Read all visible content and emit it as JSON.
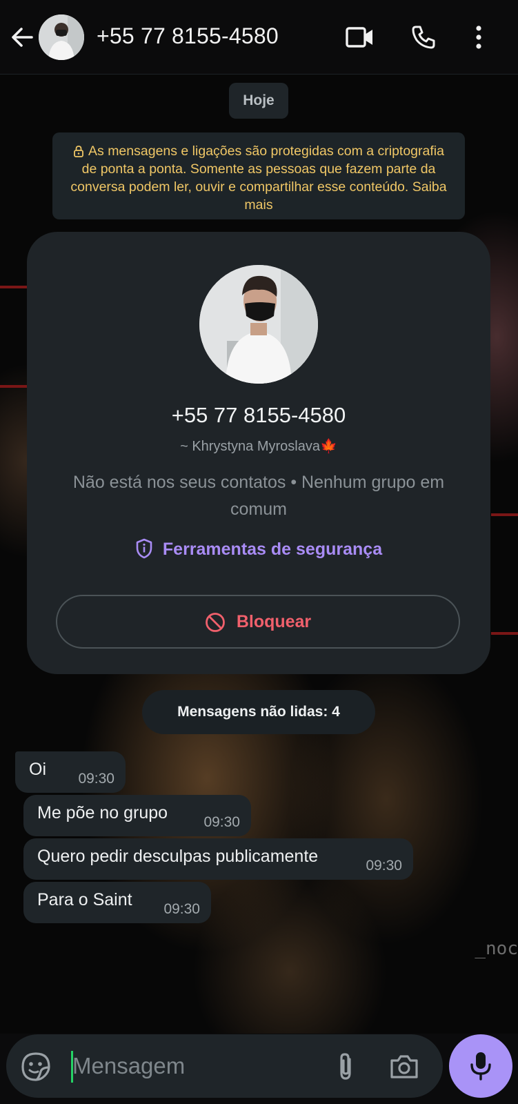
{
  "header": {
    "title": "+55 77 8155-4580",
    "back_icon": "arrow-left-icon",
    "icons": [
      "video-call-icon",
      "voice-call-icon",
      "more-vert-icon"
    ]
  },
  "chat": {
    "date_chip": "Hoje",
    "encryption_notice": "As mensagens e ligações são protegidas com a criptografia de ponta a ponta. Somente as pessoas que fazem parte da conversa podem ler, ouvir e compartilhar esse conteúdo. Saiba mais",
    "contact_card": {
      "phone": "+55 77 8155-4580",
      "name": "~ Khrystyna Myroslava🍁",
      "info": "Não está nos seus contatos • Nenhum grupo em comum",
      "security_label": "Ferramentas de segurança",
      "block_label": "Bloquear"
    },
    "unread_label": "Mensagens não lidas: 4",
    "messages": [
      {
        "text": "Oi",
        "time": "09:30"
      },
      {
        "text": "Me põe no grupo",
        "time": "09:30"
      },
      {
        "text": "Quero pedir desculpas publicamente",
        "time": "09:30"
      },
      {
        "text": "Para o Saint",
        "time": "09:30"
      }
    ],
    "wallpaper_text": "_noc"
  },
  "composer": {
    "placeholder": "Mensagem",
    "icons": [
      "sticker-icon",
      "attach-icon",
      "camera-icon",
      "mic-icon"
    ]
  },
  "colors": {
    "accent_purple": "#a993f7",
    "notice_yellow": "#f0c766",
    "danger_red": "#f0606c",
    "bubble_bg": "#1f2529"
  }
}
